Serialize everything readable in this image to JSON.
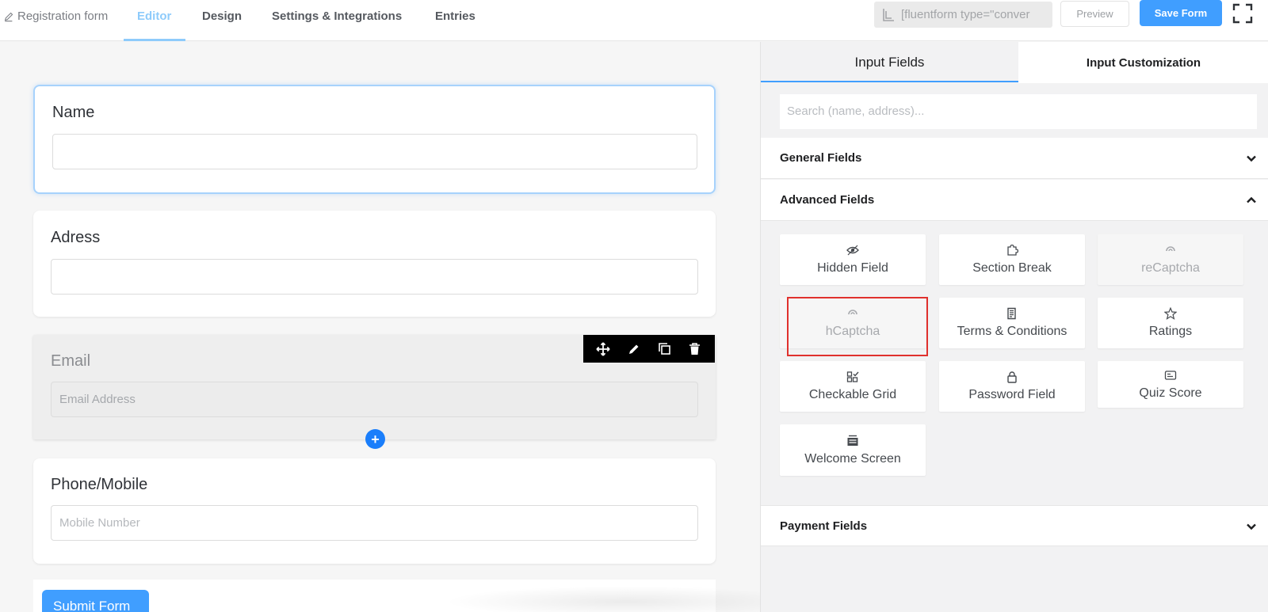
{
  "topbar": {
    "form_title": "Registration form",
    "tabs": [
      "Editor",
      "Design",
      "Settings & Integrations",
      "Entries"
    ],
    "active_tab": "Editor",
    "shortcode": "[fluentform type=\"conver",
    "preview_label": "Preview",
    "save_label": "Save Form"
  },
  "editor": {
    "fields": [
      {
        "label": "Name",
        "placeholder": ""
      },
      {
        "label": "Adress",
        "placeholder": ""
      },
      {
        "label": "Email",
        "placeholder": "Email Address"
      },
      {
        "label": "Phone/Mobile",
        "placeholder": "Mobile Number"
      }
    ],
    "add_symbol": "+",
    "submit_label": "Submit Form"
  },
  "panel": {
    "tabs": [
      "Input Fields",
      "Input Customization"
    ],
    "active_tab": "Input Fields",
    "search_placeholder": "Search (name, address)...",
    "sections": {
      "general": "General Fields",
      "advanced": "Advanced Fields",
      "payment": "Payment Fields"
    },
    "advanced_fields": [
      {
        "label": "Hidden Field",
        "icon": "eye-icon"
      },
      {
        "label": "Section Break",
        "icon": "puzzle-icon"
      },
      {
        "label": "reCaptcha",
        "icon": "captcha-icon",
        "disabled": true
      },
      {
        "label": "hCaptcha",
        "icon": "captcha-icon",
        "disabled": true,
        "highlighted": true
      },
      {
        "label": "Terms & Conditions",
        "icon": "document-icon"
      },
      {
        "label": "Ratings",
        "icon": "star-icon"
      },
      {
        "label": "Checkable Grid",
        "icon": "grid-icon"
      },
      {
        "label": "Password Field",
        "icon": "lock-icon"
      },
      {
        "label": "Quiz Score",
        "icon": "score-icon"
      },
      {
        "label": "Welcome Screen",
        "icon": "welcome-icon"
      }
    ]
  },
  "colors": {
    "primary": "#409eff",
    "active_tab": "#8ecbfb",
    "highlight": "#e0312d"
  }
}
